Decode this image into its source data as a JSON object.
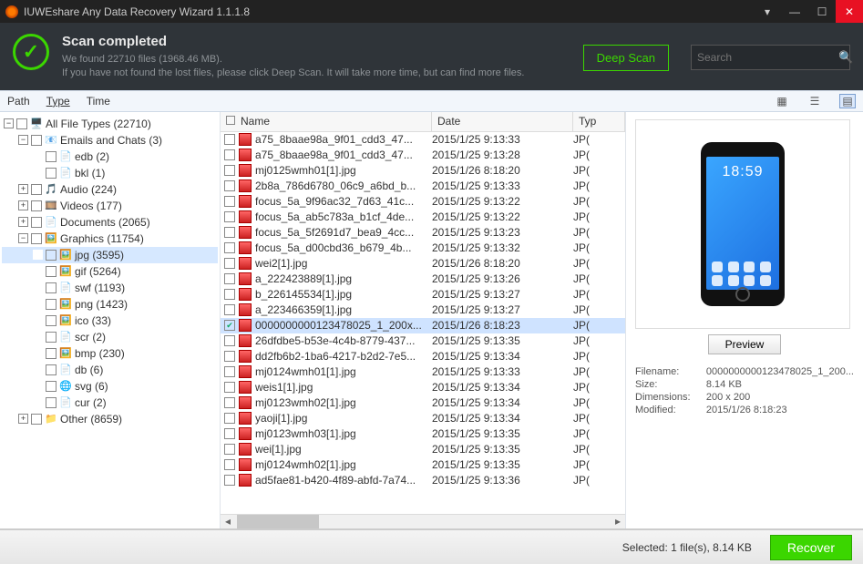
{
  "titlebar": {
    "title": "IUWEshare Any Data Recovery Wizard 1.1.1.8"
  },
  "banner": {
    "heading": "Scan completed",
    "line1": "We found 22710 files (1968.46 MB).",
    "line2": "If you have not found the lost files, please click Deep Scan. It will take more time, but can find more files.",
    "deep_scan": "Deep Scan",
    "search_placeholder": "Search"
  },
  "sortbar": {
    "path": "Path",
    "type": "Type",
    "time": "Time"
  },
  "tree": {
    "all": "All File Types (22710)",
    "emails": "Emails and Chats (3)",
    "edb": "edb (2)",
    "bkl": "bkl (1)",
    "audio": "Audio (224)",
    "videos": "Videos (177)",
    "documents": "Documents (2065)",
    "graphics": "Graphics (11754)",
    "jpg": "jpg (3595)",
    "gif": "gif (5264)",
    "swf": "swf (1193)",
    "png": "png (1423)",
    "ico": "ico (33)",
    "scr": "scr (2)",
    "bmp": "bmp (230)",
    "db": "db (6)",
    "svg": "svg (6)",
    "cur": "cur (2)",
    "other": "Other (8659)"
  },
  "list": {
    "hdr_name": "Name",
    "hdr_date": "Date",
    "hdr_type": "Typ",
    "rows": [
      {
        "n": "a75_8baae98a_9f01_cdd3_47...",
        "d": "2015/1/25 9:13:33",
        "t": "JP(",
        "c": false
      },
      {
        "n": "a75_8baae98a_9f01_cdd3_47...",
        "d": "2015/1/25 9:13:28",
        "t": "JP(",
        "c": false
      },
      {
        "n": "mj0125wmh01[1].jpg",
        "d": "2015/1/26 8:18:20",
        "t": "JP(",
        "c": false
      },
      {
        "n": "2b8a_786d6780_06c9_a6bd_b...",
        "d": "2015/1/25 9:13:33",
        "t": "JP(",
        "c": false
      },
      {
        "n": "focus_5a_9f96ac32_7d63_41c...",
        "d": "2015/1/25 9:13:22",
        "t": "JP(",
        "c": false
      },
      {
        "n": "focus_5a_ab5c783a_b1cf_4de...",
        "d": "2015/1/25 9:13:22",
        "t": "JP(",
        "c": false
      },
      {
        "n": "focus_5a_5f2691d7_bea9_4cc...",
        "d": "2015/1/25 9:13:23",
        "t": "JP(",
        "c": false
      },
      {
        "n": "focus_5a_d00cbd36_b679_4b...",
        "d": "2015/1/25 9:13:32",
        "t": "JP(",
        "c": false
      },
      {
        "n": "wei2[1].jpg",
        "d": "2015/1/26 8:18:20",
        "t": "JP(",
        "c": false
      },
      {
        "n": "a_222423889[1].jpg",
        "d": "2015/1/25 9:13:26",
        "t": "JP(",
        "c": false
      },
      {
        "n": "b_226145534[1].jpg",
        "d": "2015/1/25 9:13:27",
        "t": "JP(",
        "c": false
      },
      {
        "n": "a_223466359[1].jpg",
        "d": "2015/1/25 9:13:27",
        "t": "JP(",
        "c": false
      },
      {
        "n": "0000000000123478025_1_200x...",
        "d": "2015/1/26 8:18:23",
        "t": "JP(",
        "c": true,
        "sel": true
      },
      {
        "n": "26dfdbe5-b53e-4c4b-8779-437...",
        "d": "2015/1/25 9:13:35",
        "t": "JP(",
        "c": false
      },
      {
        "n": "dd2fb6b2-1ba6-4217-b2d2-7e5...",
        "d": "2015/1/25 9:13:34",
        "t": "JP(",
        "c": false
      },
      {
        "n": "mj0124wmh01[1].jpg",
        "d": "2015/1/25 9:13:33",
        "t": "JP(",
        "c": false
      },
      {
        "n": "weis1[1].jpg",
        "d": "2015/1/25 9:13:34",
        "t": "JP(",
        "c": false
      },
      {
        "n": "mj0123wmh02[1].jpg",
        "d": "2015/1/25 9:13:34",
        "t": "JP(",
        "c": false
      },
      {
        "n": "yaoji[1].jpg",
        "d": "2015/1/25 9:13:34",
        "t": "JP(",
        "c": false
      },
      {
        "n": "mj0123wmh03[1].jpg",
        "d": "2015/1/25 9:13:35",
        "t": "JP(",
        "c": false
      },
      {
        "n": "wei[1].jpg",
        "d": "2015/1/25 9:13:35",
        "t": "JP(",
        "c": false
      },
      {
        "n": "mj0124wmh02[1].jpg",
        "d": "2015/1/25 9:13:35",
        "t": "JP(",
        "c": false
      },
      {
        "n": "ad5fae81-b420-4f89-abfd-7a74...",
        "d": "2015/1/25 9:13:36",
        "t": "JP(",
        "c": false
      }
    ]
  },
  "preview": {
    "clock": "18:59",
    "btn": "Preview",
    "filename_lbl": "Filename:",
    "filename": "0000000000123478025_1_200...",
    "size_lbl": "Size:",
    "size": "8.14 KB",
    "dims_lbl": "Dimensions:",
    "dims": "200 x 200",
    "mod_lbl": "Modified:",
    "mod": "2015/1/26 8:18:23"
  },
  "footer": {
    "selected": "Selected:  1 file(s), 8.14 KB",
    "recover": "Recover"
  }
}
